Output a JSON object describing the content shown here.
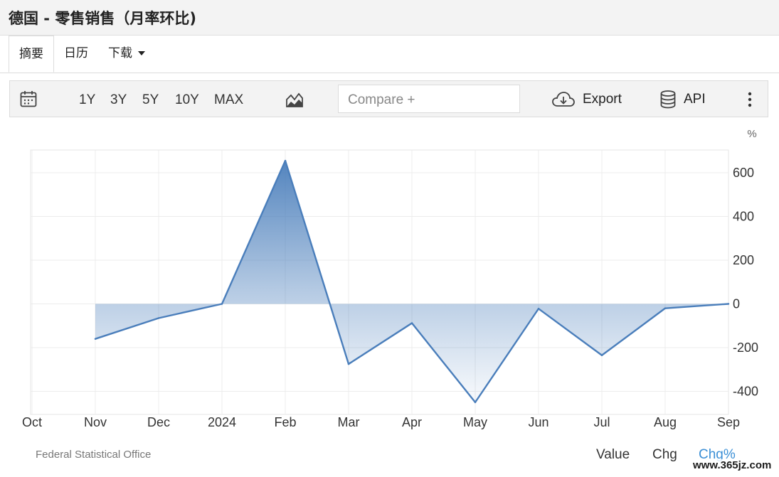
{
  "title": "德国 - 零售销售（月率环比)",
  "tabs": [
    "摘要",
    "日历",
    "下载"
  ],
  "toolbar": {
    "ranges": [
      "1Y",
      "3Y",
      "5Y",
      "10Y",
      "MAX"
    ],
    "compare_placeholder": "Compare +",
    "export_label": "Export",
    "api_label": "API",
    "icons": [
      "calendar-icon",
      "chart-type-icon",
      "cloud-download-icon",
      "database-icon",
      "more-vertical-icon"
    ]
  },
  "chart_data": {
    "type": "area",
    "title": "",
    "unit": "%",
    "categories": [
      "Oct",
      "Nov",
      "Dec",
      "2024",
      "Feb",
      "Mar",
      "Apr",
      "May",
      "Jun",
      "Jul",
      "Aug",
      "Sep"
    ],
    "series": [
      {
        "values": [
          null,
          -160,
          -65,
          0,
          655,
          -275,
          -88,
          -450,
          -22,
          -235,
          -20,
          0
        ]
      }
    ],
    "yticks": [
      600,
      400,
      200,
      0,
      -200,
      -400
    ],
    "ylim": [
      -500,
      700
    ],
    "grid": true,
    "color": "#4a7ebb"
  },
  "footer": {
    "source": "Federal Statistical Office",
    "modes": [
      "Value",
      "Chg",
      "Chg%"
    ],
    "selected_mode": "Chg%",
    "watermark": "www.365jz.com"
  }
}
